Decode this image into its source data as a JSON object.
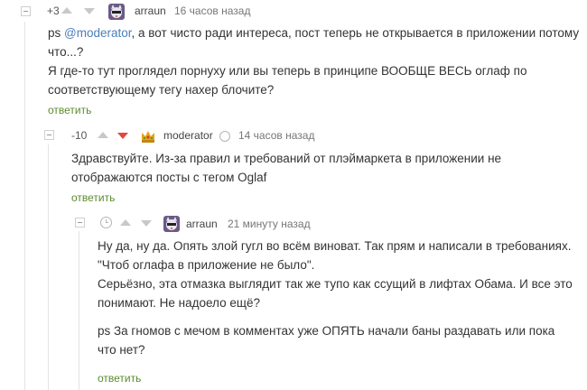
{
  "comments": [
    {
      "rating": "+3",
      "author": "arraun",
      "time": "16 часов назад",
      "body_prefix": "ps ",
      "mention": "@moderator",
      "body_lines_1": [
        ", а вот чисто ради интереса, пост теперь не открывается в приложении потому",
        "что...?"
      ],
      "body_lines_2": [
        "Я где-то тут проглядел порнуху или вы теперь в принципе ВООБЩЕ ВЕСЬ оглаф по",
        "соответствующему тегу нахер блочите?"
      ],
      "reply": "ответить"
    },
    {
      "rating": "-10",
      "author": "moderator",
      "time": "14 часов назад",
      "body_lines": [
        "Здравствуйте. Из-за правил и требований от плэймаркета в приложении не",
        "отображаются посты с тегом Oglaf"
      ],
      "reply": "ответить"
    },
    {
      "rating": "",
      "author": "arraun",
      "time": "21 минуту назад",
      "body_lines": [
        "Ну да, ну да. Опять злой гугл во всём виноват. Так прям и написали в требованиях.",
        "\"Чтоб оглафа в приложение не было\".",
        "Серьёзно, эта отмазка выглядит так же тупо как ссущий в лифтах Обама. И все это",
        "понимают. Не надоело ещё?",
        "",
        "ps За гномов с мечом в комментах уже ОПЯТЬ начали баны раздавать или пока",
        "что нет?"
      ],
      "reply": "ответить"
    }
  ],
  "colors": {
    "link": "#5c8b2e",
    "mention": "#4b7fb8",
    "downvote_active": "#e1483b",
    "arrow": "#c8c8c8"
  }
}
